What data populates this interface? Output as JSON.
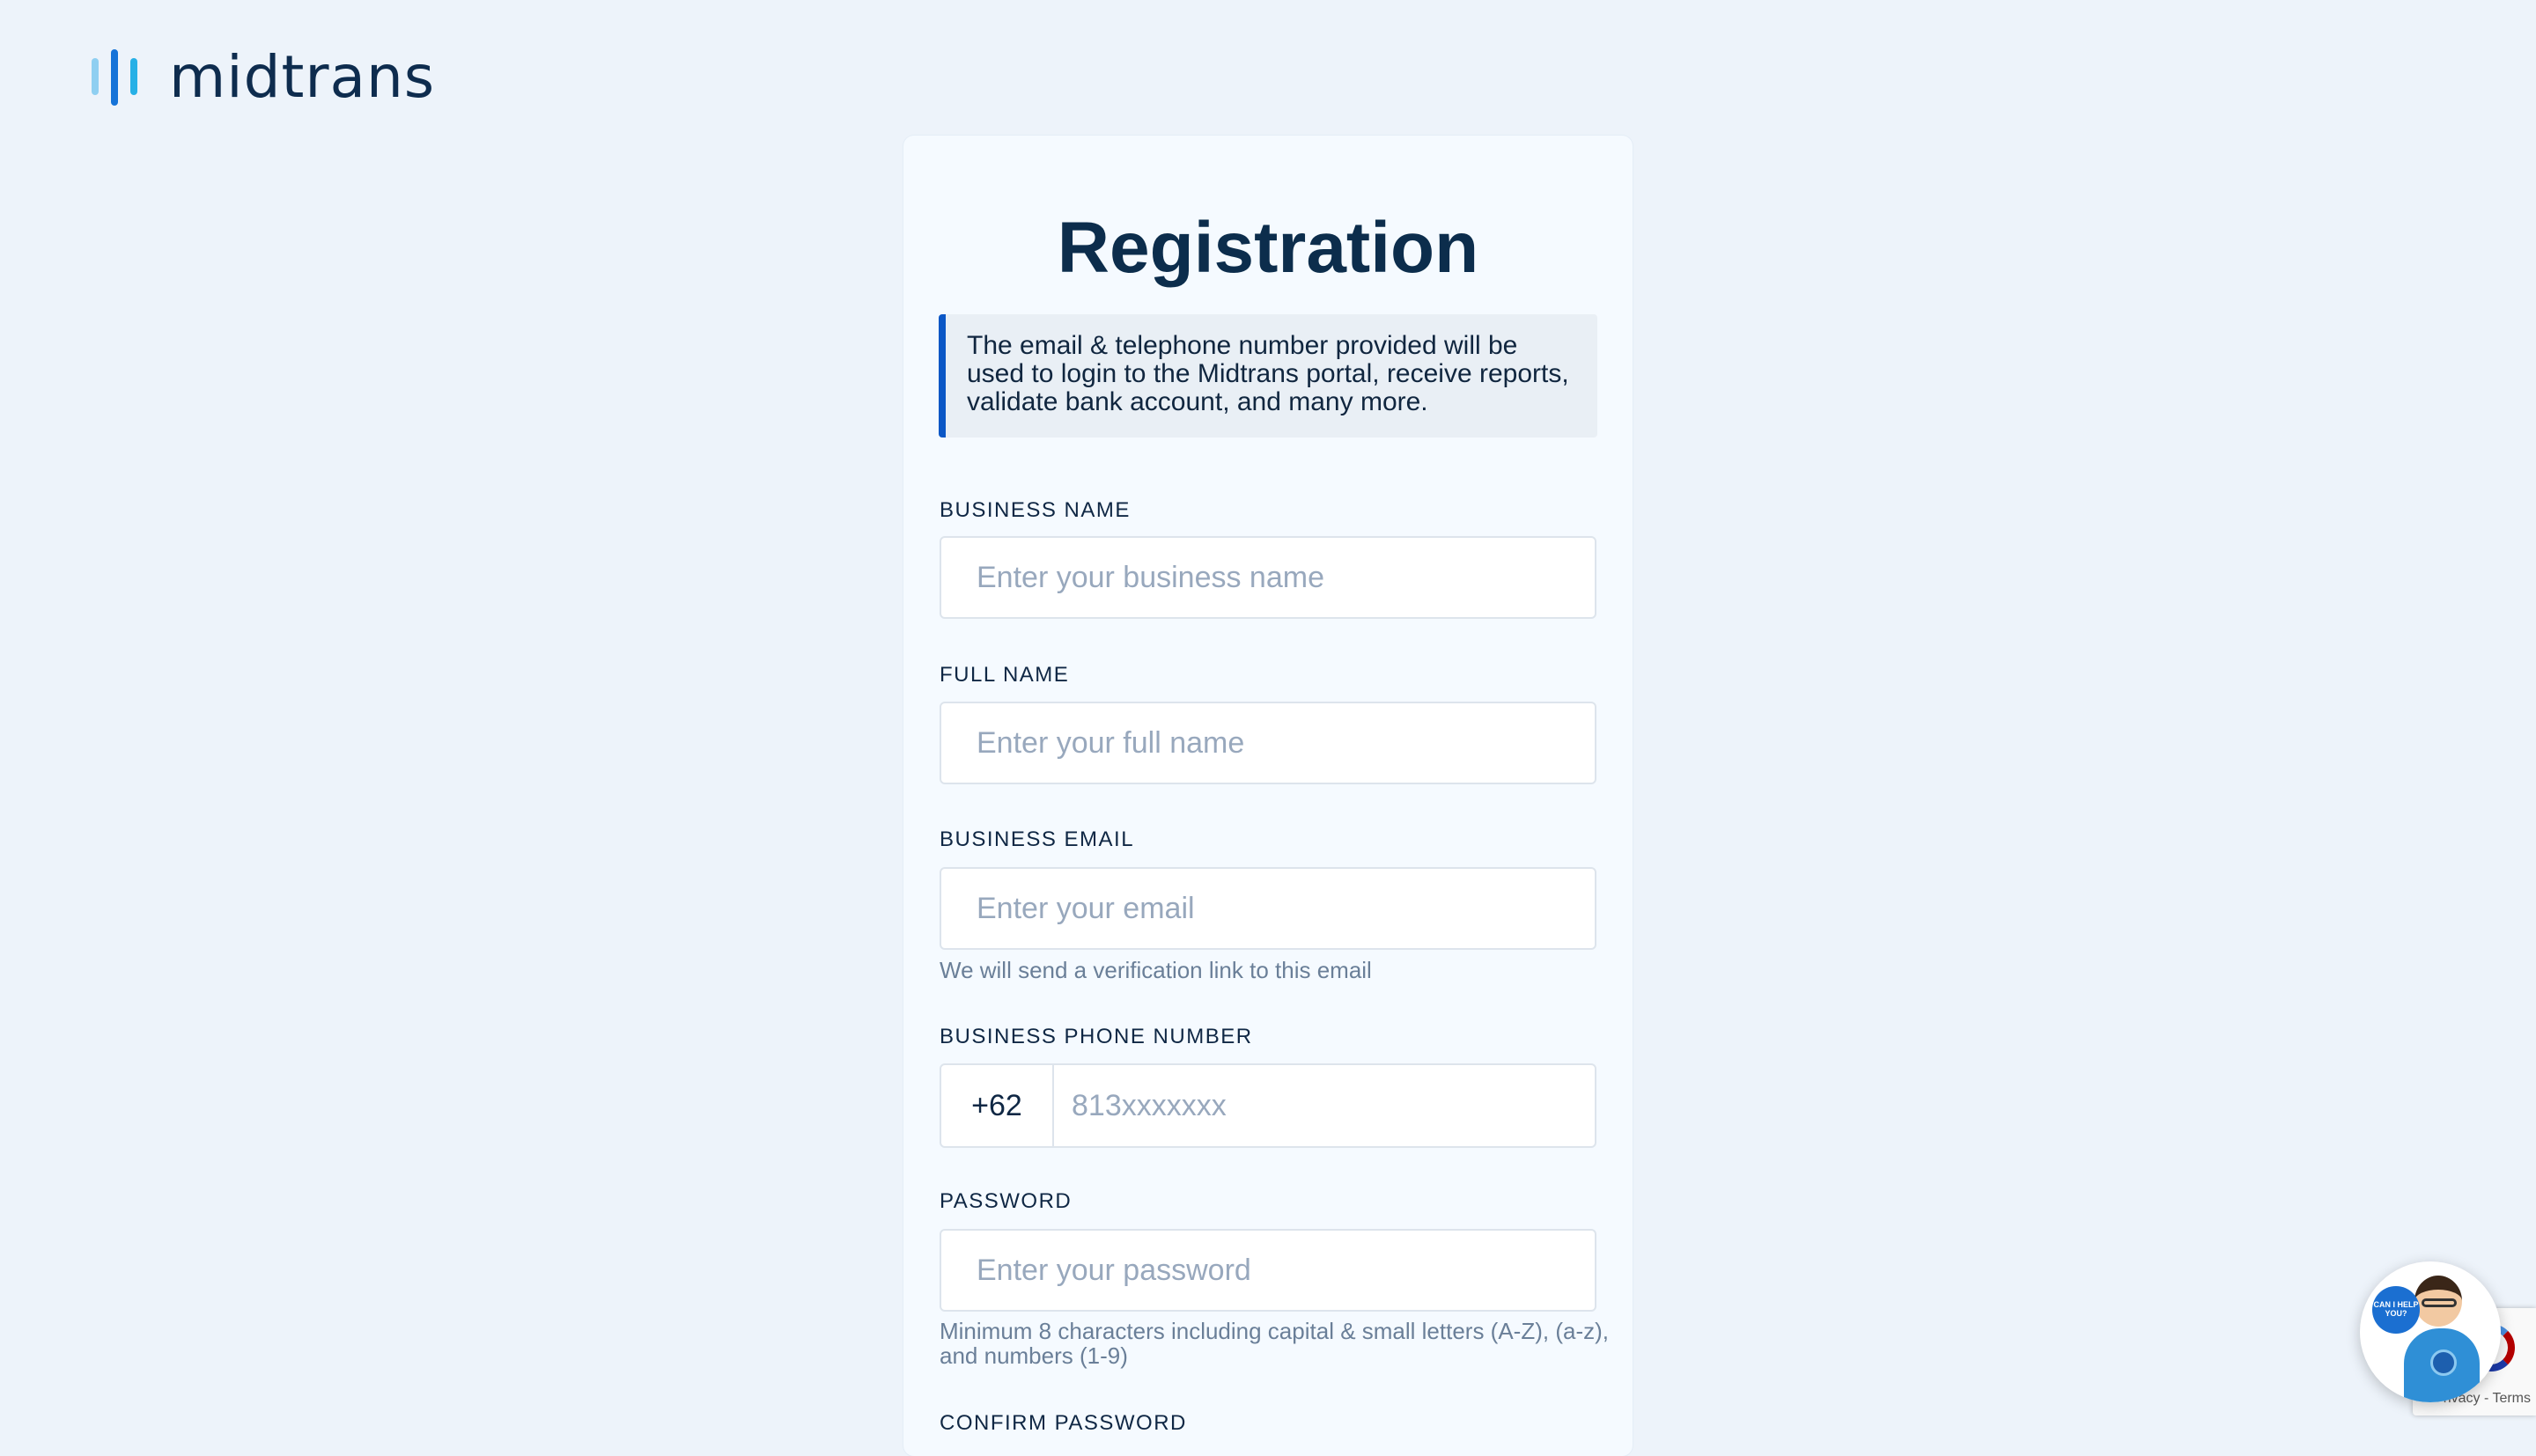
{
  "logo": {
    "text": "midtrans",
    "mark_colors": [
      "#8fcff1",
      "#1573d8",
      "#27b0e6"
    ]
  },
  "page": {
    "title": "Registration",
    "notice": "The email & telephone number provided will be used to login to the Midtrans portal, receive reports, validate bank account, and many more."
  },
  "form": {
    "business_name": {
      "label": "BUSINESS NAME",
      "placeholder": "Enter your business name"
    },
    "full_name": {
      "label": "FULL NAME",
      "placeholder": "Enter your full name"
    },
    "business_email": {
      "label": "BUSINESS EMAIL",
      "placeholder": "Enter your email",
      "hint": "We will send a verification link to this email"
    },
    "phone": {
      "label": "BUSINESS PHONE NUMBER",
      "prefix": "+62",
      "placeholder": "813xxxxxxx"
    },
    "password": {
      "label": "PASSWORD",
      "placeholder": "Enter your password",
      "hint": "Minimum 8 characters including capital & small letters (A-Z), (a-z), and numbers (1-9)"
    },
    "confirm_password": {
      "label": "CONFIRM PASSWORD"
    }
  },
  "recaptcha": {
    "links": "rivacy - Terms"
  },
  "chat_widget": {
    "bubble_text": "CAN I HELP YOU?"
  },
  "colors": {
    "background": "#edf3fa",
    "card": "#f5faff",
    "accent": "#0b57c6",
    "text_primary": "#0c2d4c",
    "placeholder": "#98a8bd"
  }
}
